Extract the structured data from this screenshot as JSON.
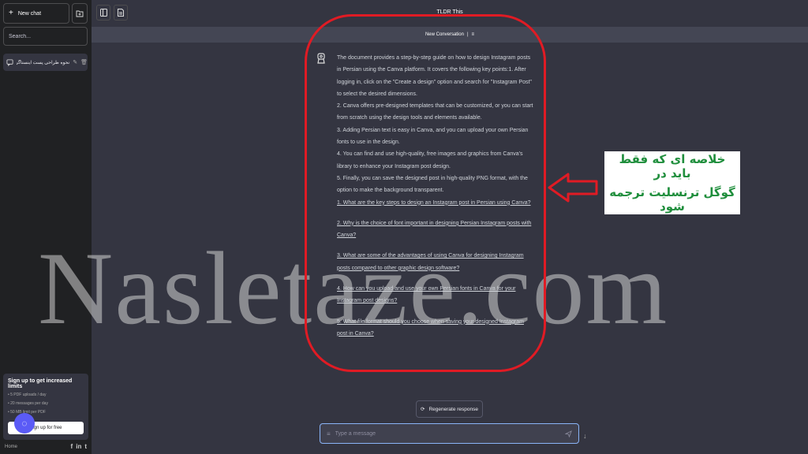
{
  "sidebar": {
    "new_chat_label": "New chat",
    "search_placeholder": "Search...",
    "conversations": [
      {
        "title": "نحوه طراحی پست اینستاگرام فارسی با ..."
      }
    ],
    "upgrade": {
      "title": "Sign up to get increased limits",
      "features": [
        "5 PDF uploads / day",
        "20 messages per day",
        "50 MB limit per PDF"
      ],
      "button_label": "Sign up for free"
    },
    "footer_link": "Home",
    "social_icons": [
      "f",
      "in",
      "t"
    ]
  },
  "header": {
    "app_title": "TLDR This",
    "conversation_title": "New Conversation"
  },
  "message": {
    "intro": "The document provides a step-by-step guide on how to design Instagram posts in Persian using the Canva platform. It covers the following key points:1. After logging in, click on the \"Create a design\" option and search for \"Instagram Post\" to select the desired dimensions.",
    "points": [
      "2. Canva offers pre-designed templates that can be customized, or you can start from scratch using the design tools and elements available.",
      "3. Adding Persian text is easy in Canva, and you can upload your own Persian fonts to use in the design.",
      "4. You can find and use high-quality, free images and graphics from Canva's library to enhance your Instagram post design.",
      "5. Finally, you can save the designed post in high-quality PNG format, with the option to make the background transparent."
    ],
    "questions": [
      "1. What are the key steps to design an Instagram post in Persian using Canva?",
      "2. Why is the choice of font important in designing Persian Instagram posts with Canva?",
      "3. What are some of the advantages of using Canva for designing Instagram posts compared to other graphic design software?",
      "4. How can you upload and use your own Persian fonts in Canva for your Instagram post designs?",
      "5. What file format should you choose when saving your designed Instagram post in Canva?"
    ]
  },
  "annotation": {
    "line1": "خلاصه ای که فقط باید در",
    "line2": "گوگل ترنسلیت ترجمه شود",
    "highlight_color": "#e01b24"
  },
  "watermark": "Nasletaze.com",
  "composer": {
    "regenerate_label": "Regenerate response",
    "input_placeholder": "Type a message"
  }
}
